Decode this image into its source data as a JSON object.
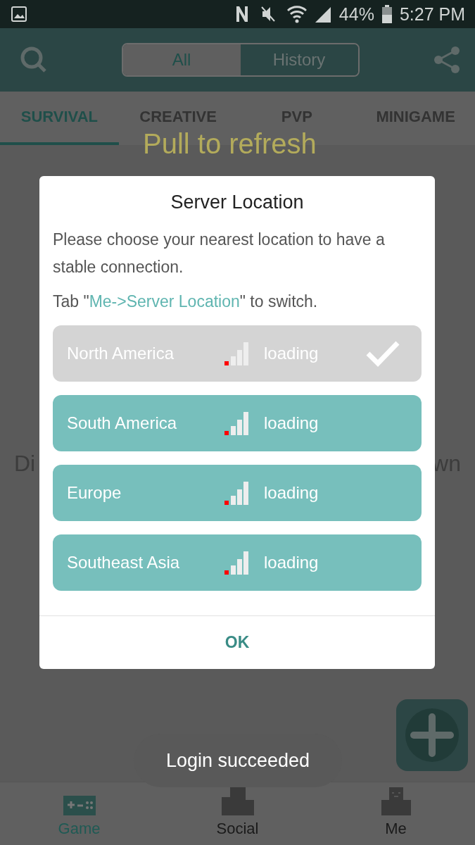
{
  "status_bar": {
    "battery": "44%",
    "time": "5:27 PM"
  },
  "header": {
    "segments": [
      {
        "label": "All",
        "selected": true
      },
      {
        "label": "History",
        "selected": false
      }
    ]
  },
  "categories": [
    {
      "label": "SURVIVAL",
      "selected": true
    },
    {
      "label": "CREATIVE",
      "selected": false
    },
    {
      "label": "PVP",
      "selected": false
    },
    {
      "label": "MINIGAME",
      "selected": false
    }
  ],
  "pull_hint": "Pull to refresh",
  "background_message": {
    "start": "Di",
    "end": "wn"
  },
  "dialog": {
    "title": "Server Location",
    "message": "Please choose your nearest location to have a stable connection.",
    "hint_before": "Tab \"",
    "hint_link": "Me->Server Location",
    "hint_after": "\" to switch.",
    "regions": [
      {
        "name": "North America",
        "status": "loading",
        "selected": true
      },
      {
        "name": "South America",
        "status": "loading",
        "selected": false
      },
      {
        "name": "Europe",
        "status": "loading",
        "selected": false
      },
      {
        "name": "Southeast Asia",
        "status": "loading",
        "selected": false
      }
    ],
    "button": "OK"
  },
  "toast": "Login succeeded",
  "bottom_nav": [
    {
      "label": "Game",
      "kind": "game",
      "selected": true
    },
    {
      "label": "Social",
      "kind": "social",
      "selected": false
    },
    {
      "label": "Me",
      "kind": "me",
      "selected": false
    }
  ]
}
